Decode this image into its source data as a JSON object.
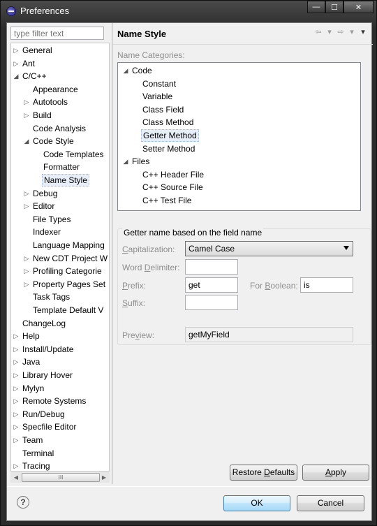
{
  "window": {
    "title": "Preferences",
    "min_glyph": "—",
    "max_glyph": "☐",
    "close_glyph": "✕"
  },
  "filter": {
    "placeholder": "type filter text"
  },
  "left_tree": [
    {
      "label": "General",
      "arrow": "▷"
    },
    {
      "label": "Ant",
      "arrow": "▷"
    },
    {
      "label": "C/C++",
      "arrow": "◢"
    },
    {
      "label": "Appearance",
      "arrow": ""
    },
    {
      "label": "Autotools",
      "arrow": "▷"
    },
    {
      "label": "Build",
      "arrow": "▷"
    },
    {
      "label": "Code Analysis",
      "arrow": ""
    },
    {
      "label": "Code Style",
      "arrow": "◢"
    },
    {
      "label": "Code Templates",
      "arrow": ""
    },
    {
      "label": "Formatter",
      "arrow": ""
    },
    {
      "label": "Name Style",
      "arrow": ""
    },
    {
      "label": "Debug",
      "arrow": "▷"
    },
    {
      "label": "Editor",
      "arrow": "▷"
    },
    {
      "label": "File Types",
      "arrow": ""
    },
    {
      "label": "Indexer",
      "arrow": ""
    },
    {
      "label": "Language Mapping",
      "arrow": ""
    },
    {
      "label": "New CDT Project W",
      "arrow": "▷"
    },
    {
      "label": "Profiling Categorie",
      "arrow": "▷"
    },
    {
      "label": "Property Pages Set",
      "arrow": "▷"
    },
    {
      "label": "Task Tags",
      "arrow": ""
    },
    {
      "label": "Template Default V",
      "arrow": ""
    },
    {
      "label": "ChangeLog",
      "arrow": ""
    },
    {
      "label": "Help",
      "arrow": "▷"
    },
    {
      "label": "Install/Update",
      "arrow": "▷"
    },
    {
      "label": "Java",
      "arrow": "▷"
    },
    {
      "label": "Library Hover",
      "arrow": "▷"
    },
    {
      "label": "Mylyn",
      "arrow": "▷"
    },
    {
      "label": "Remote Systems",
      "arrow": "▷"
    },
    {
      "label": "Run/Debug",
      "arrow": "▷"
    },
    {
      "label": "Specfile Editor",
      "arrow": "▷"
    },
    {
      "label": "Team",
      "arrow": "▷"
    },
    {
      "label": "Terminal",
      "arrow": ""
    },
    {
      "label": "Tracing",
      "arrow": "▷"
    }
  ],
  "hscroll": {
    "left": "◀",
    "right": "▶",
    "grip": "III"
  },
  "page": {
    "title": "Name Style",
    "nav": {
      "back": "⇦",
      "back_menu": "▾",
      "forward": "⇨",
      "forward_menu": "▾",
      "view_menu": "▾"
    },
    "categories_label": "Name Categories:",
    "categories": [
      {
        "label": "Code",
        "arrow": "◢"
      },
      {
        "label": "Constant",
        "arrow": ""
      },
      {
        "label": "Variable",
        "arrow": ""
      },
      {
        "label": "Class Field",
        "arrow": ""
      },
      {
        "label": "Class Method",
        "arrow": ""
      },
      {
        "label": "Getter Method",
        "arrow": ""
      },
      {
        "label": "Setter Method",
        "arrow": ""
      },
      {
        "label": "Files",
        "arrow": "◢"
      },
      {
        "label": "C++ Header File",
        "arrow": ""
      },
      {
        "label": "C++ Source File",
        "arrow": ""
      },
      {
        "label": "C++ Test File",
        "arrow": ""
      }
    ],
    "group_title": "Getter name based on the field name",
    "capitalization": {
      "label": "Capitalization:",
      "value": "Camel Case"
    },
    "word_delimiter": {
      "label": "Word Delimiter:",
      "value": ""
    },
    "prefix": {
      "label": "Prefix:",
      "value": "get"
    },
    "for_boolean": {
      "label": "For Boolean:",
      "value": "is"
    },
    "suffix": {
      "label": "Suffix:",
      "value": ""
    },
    "preview": {
      "label": "Preview:",
      "value": "getMyField"
    },
    "restore_defaults": "Restore Defaults",
    "apply": "Apply"
  },
  "footer": {
    "help": "?",
    "ok": "OK",
    "cancel": "Cancel"
  }
}
